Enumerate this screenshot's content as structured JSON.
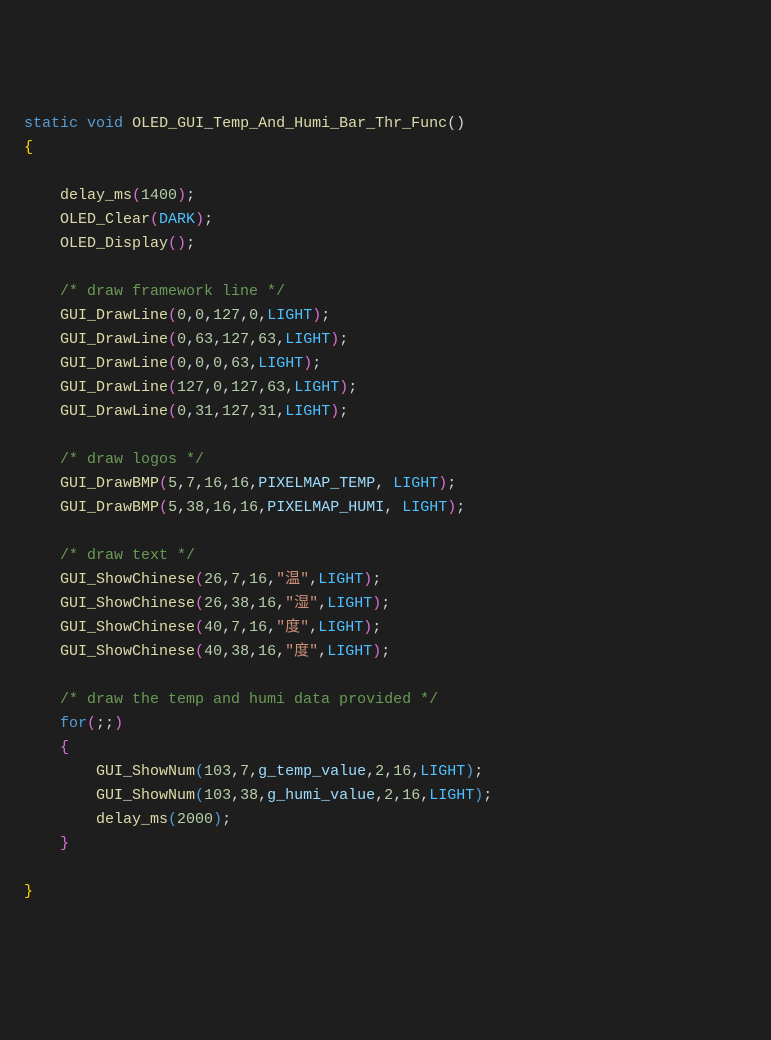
{
  "code": {
    "sig": {
      "kw_static": "static",
      "kw_void": "void",
      "fn_name": "OLED_GUI_Temp_And_Humi_Bar_Thr_Func"
    },
    "body": {
      "delay1": {
        "fn": "delay_ms",
        "arg": "1400"
      },
      "clear": {
        "fn": "OLED_Clear",
        "arg": "DARK"
      },
      "display": {
        "fn": "OLED_Display"
      },
      "cmt1": "/* draw framework line */",
      "dl1": {
        "fn": "GUI_DrawLine",
        "a1": "0",
        "a2": "0",
        "a3": "127",
        "a4": "0",
        "a5": "LIGHT"
      },
      "dl2": {
        "fn": "GUI_DrawLine",
        "a1": "0",
        "a2": "63",
        "a3": "127",
        "a4": "63",
        "a5": "LIGHT"
      },
      "dl3": {
        "fn": "GUI_DrawLine",
        "a1": "0",
        "a2": "0",
        "a3": "0",
        "a4": "63",
        "a5": "LIGHT"
      },
      "dl4": {
        "fn": "GUI_DrawLine",
        "a1": "127",
        "a2": "0",
        "a3": "127",
        "a4": "63",
        "a5": "LIGHT"
      },
      "dl5": {
        "fn": "GUI_DrawLine",
        "a1": "0",
        "a2": "31",
        "a3": "127",
        "a4": "31",
        "a5": "LIGHT"
      },
      "cmt2": "/* draw logos */",
      "b1": {
        "fn": "GUI_DrawBMP",
        "a1": "5",
        "a2": "7",
        "a3": "16",
        "a4": "16",
        "a5": "PIXELMAP_TEMP",
        "a6": "LIGHT"
      },
      "b2": {
        "fn": "GUI_DrawBMP",
        "a1": "5",
        "a2": "38",
        "a3": "16",
        "a4": "16",
        "a5": "PIXELMAP_HUMI",
        "a6": "LIGHT"
      },
      "cmt3": "/* draw text */",
      "s1": {
        "fn": "GUI_ShowChinese",
        "a1": "26",
        "a2": "7",
        "a3": "16",
        "s": "\"温\"",
        "a5": "LIGHT"
      },
      "s2": {
        "fn": "GUI_ShowChinese",
        "a1": "26",
        "a2": "38",
        "a3": "16",
        "s": "\"湿\"",
        "a5": "LIGHT"
      },
      "s3": {
        "fn": "GUI_ShowChinese",
        "a1": "40",
        "a2": "7",
        "a3": "16",
        "s": "\"度\"",
        "a5": "LIGHT"
      },
      "s4": {
        "fn": "GUI_ShowChinese",
        "a1": "40",
        "a2": "38",
        "a3": "16",
        "s": "\"度\"",
        "a5": "LIGHT"
      },
      "cmt4": "/* draw the temp and humi data provided */",
      "for_kw": "for",
      "n1": {
        "fn": "GUI_ShowNum",
        "a1": "103",
        "a2": "7",
        "v": "g_temp_value",
        "a4": "2",
        "a5": "16",
        "a6": "LIGHT"
      },
      "n2": {
        "fn": "GUI_ShowNum",
        "a1": "103",
        "a2": "38",
        "v": "g_humi_value",
        "a4": "2",
        "a5": "16",
        "a6": "LIGHT"
      },
      "delay2": {
        "fn": "delay_ms",
        "arg": "2000"
      }
    }
  }
}
